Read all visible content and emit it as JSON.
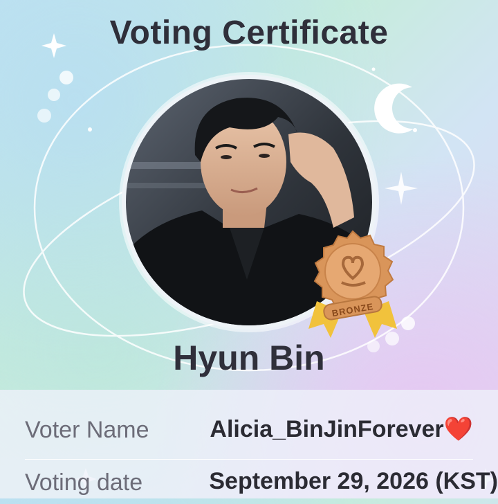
{
  "certificate": {
    "title": "Voting Certificate",
    "artist_name": "Hyun Bin",
    "badge": {
      "tier": "BRONZE",
      "color": "#d9955a",
      "ribbon_color": "#f1c23c"
    }
  },
  "details": {
    "voter_label": "Voter Name",
    "voter_value": "Alicia_BinJinForever",
    "voter_emoji": "❤️",
    "date_label": "Voting date",
    "date_value": "September 29, 2026 (KST)"
  },
  "colors": {
    "text_dark": "#2f2f3a",
    "label_gray": "#6c6c78",
    "heart_red": "#e0182c"
  }
}
